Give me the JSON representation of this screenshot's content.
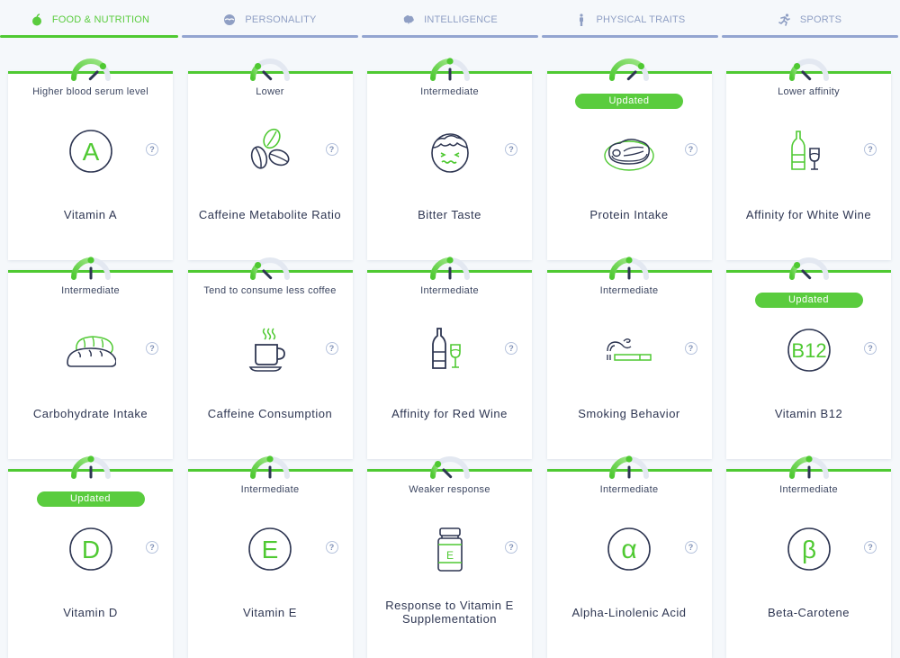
{
  "tabs": [
    {
      "label": "FOOD & NUTRITION",
      "icon": "apple-icon",
      "active": true
    },
    {
      "label": "PERSONALITY",
      "icon": "mask-icon",
      "active": false
    },
    {
      "label": "INTELLIGENCE",
      "icon": "brain-icon",
      "active": false
    },
    {
      "label": "PHYSICAL TRAITS",
      "icon": "person-icon",
      "active": false
    },
    {
      "label": "SPORTS",
      "icon": "runner-icon",
      "active": false
    }
  ],
  "colors": {
    "accent": "#4fc932",
    "inactive_tab": "#93a5d0",
    "text": "#2e3652",
    "gauge_track": "#e3e8f1",
    "needle": "#2e3652"
  },
  "cards": [
    {
      "title": "Vitamin A",
      "status": "Higher blood serum level",
      "badge": null,
      "gauge_level": 0.75,
      "icon": "vitamin-a-icon",
      "glyph": "A"
    },
    {
      "title": "Caffeine Metabolite Ratio",
      "status": "Lower",
      "badge": null,
      "gauge_level": 0.25,
      "icon": "coffee-beans-icon"
    },
    {
      "title": "Bitter Taste",
      "status": "Intermediate",
      "badge": null,
      "gauge_level": 0.5,
      "icon": "bitter-face-icon"
    },
    {
      "title": "Protein Intake",
      "status": null,
      "badge": "Updated",
      "gauge_level": 0.75,
      "icon": "steak-icon"
    },
    {
      "title": "Affinity for White Wine",
      "status": "Lower affinity",
      "badge": null,
      "gauge_level": 0.25,
      "icon": "white-wine-icon"
    },
    {
      "title": "Carbohydrate Intake",
      "status": "Intermediate",
      "badge": null,
      "gauge_level": 0.5,
      "icon": "bread-icon"
    },
    {
      "title": "Caffeine Consumption",
      "status": "Tend to consume less coffee",
      "badge": null,
      "gauge_level": 0.25,
      "icon": "coffee-cup-icon"
    },
    {
      "title": "Affinity for Red Wine",
      "status": "Intermediate",
      "badge": null,
      "gauge_level": 0.5,
      "icon": "red-wine-icon"
    },
    {
      "title": "Smoking Behavior",
      "status": "Intermediate",
      "badge": null,
      "gauge_level": 0.5,
      "icon": "cigarette-icon"
    },
    {
      "title": "Vitamin B12",
      "status": null,
      "badge": "Updated",
      "gauge_level": 0.25,
      "icon": "vitamin-b12-icon",
      "glyph": "B12"
    },
    {
      "title": "Vitamin D",
      "status": null,
      "badge": "Updated",
      "gauge_level": 0.5,
      "icon": "vitamin-d-icon",
      "glyph": "D"
    },
    {
      "title": "Vitamin E",
      "status": "Intermediate",
      "badge": null,
      "gauge_level": 0.5,
      "icon": "vitamin-e-icon",
      "glyph": "E"
    },
    {
      "title": "Response to Vitamin E Supplementation",
      "status": "Weaker response",
      "badge": null,
      "gauge_level": 0.25,
      "icon": "supplement-bottle-icon",
      "glyph": "E"
    },
    {
      "title": "Alpha-Linolenic Acid",
      "status": "Intermediate",
      "badge": null,
      "gauge_level": 0.5,
      "icon": "alpha-icon",
      "glyph": "α"
    },
    {
      "title": "Beta-Carotene",
      "status": "Intermediate",
      "badge": null,
      "gauge_level": 0.5,
      "icon": "beta-icon",
      "glyph": "β"
    }
  ],
  "help_glyph": "?"
}
